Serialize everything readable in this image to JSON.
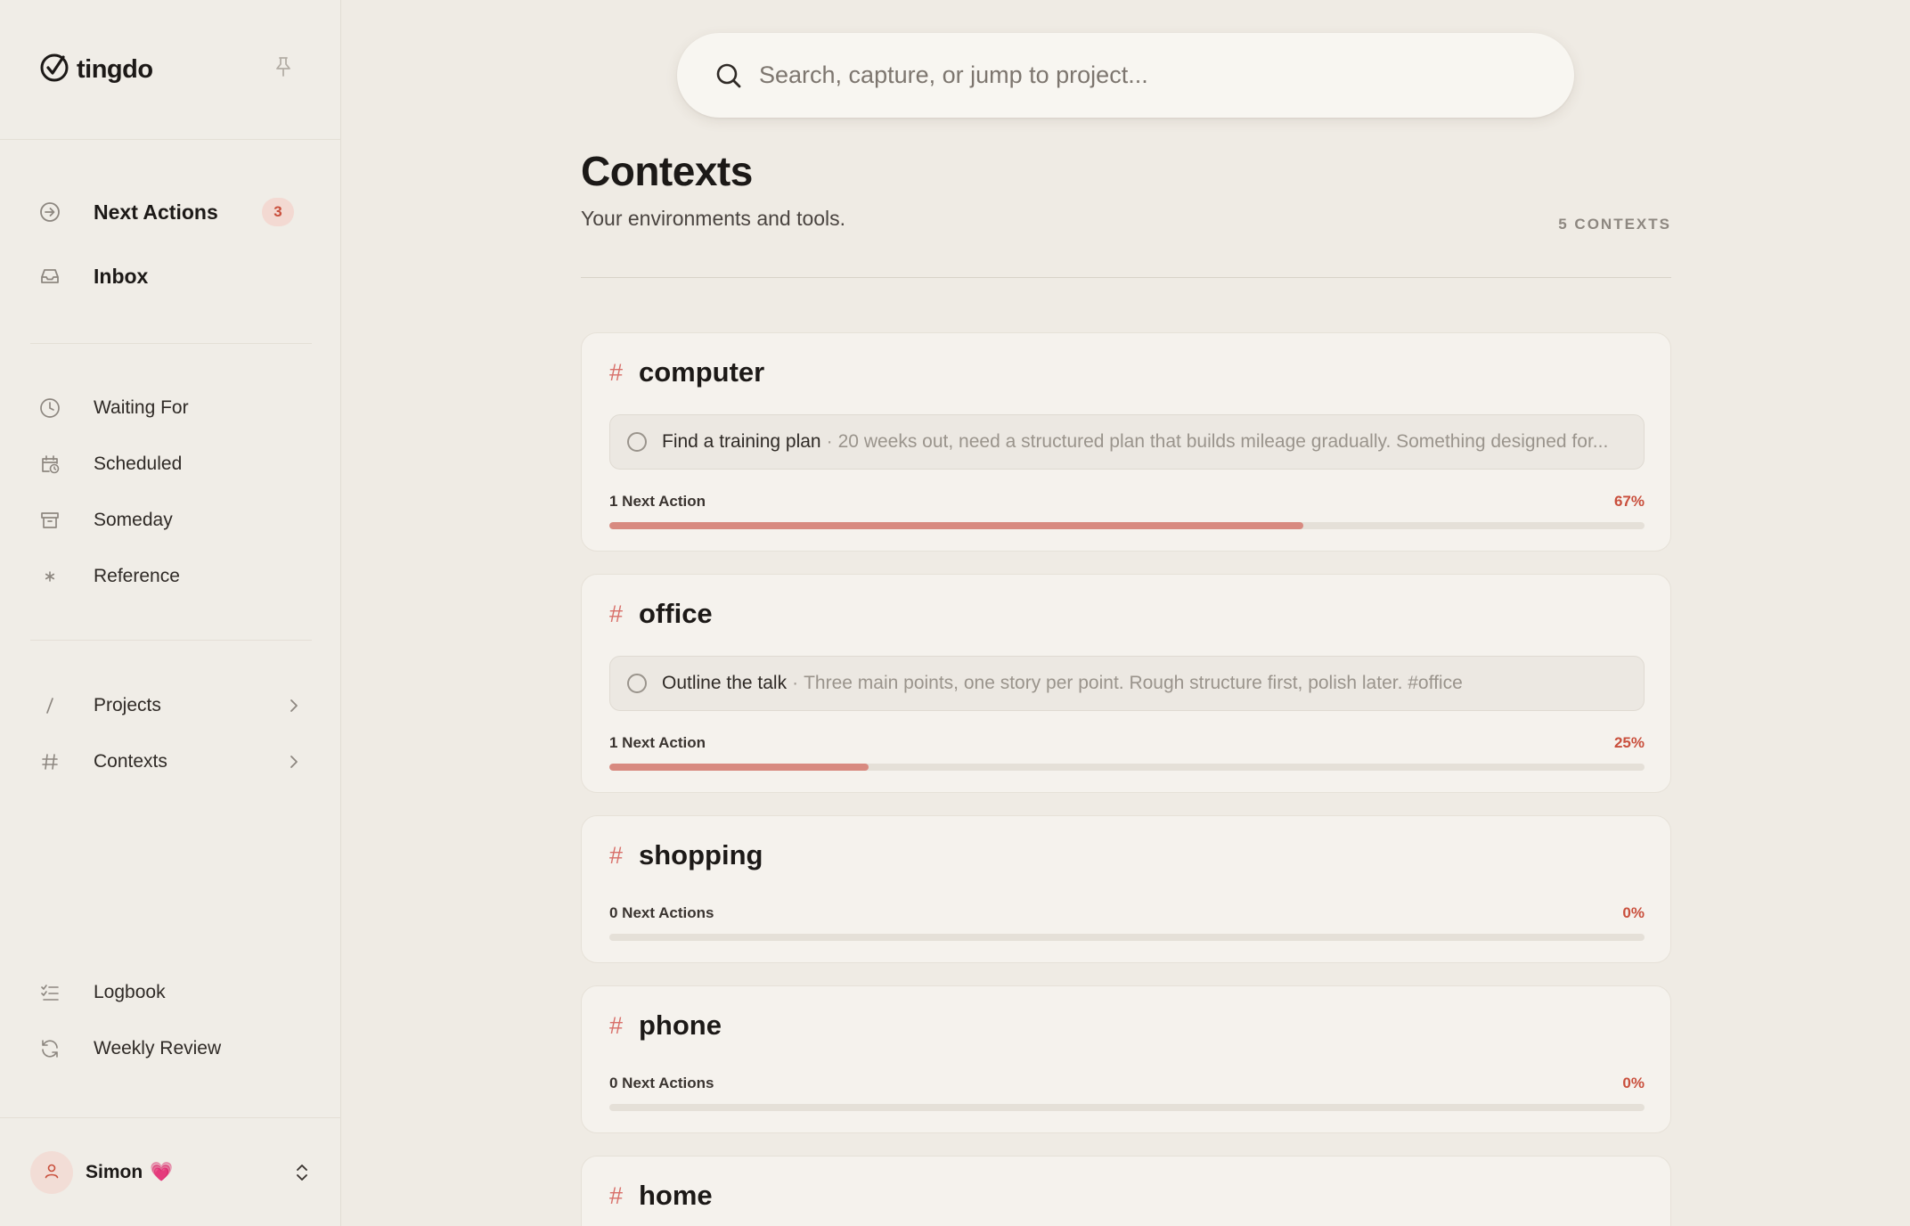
{
  "app": {
    "name": "tingdo"
  },
  "sidebar": {
    "primary": [
      {
        "label": "Next Actions",
        "badge": "3",
        "icon": "arrow-circle-right-icon"
      },
      {
        "label": "Inbox",
        "icon": "inbox-tray-icon"
      }
    ],
    "secondary": [
      {
        "label": "Waiting For",
        "icon": "clock-icon"
      },
      {
        "label": "Scheduled",
        "icon": "calendar-clock-icon"
      },
      {
        "label": "Someday",
        "icon": "archive-box-icon"
      },
      {
        "label": "Reference",
        "icon": "asterisk-icon"
      }
    ],
    "collections": [
      {
        "label": "Projects",
        "icon": "slash-icon"
      },
      {
        "label": "Contexts",
        "icon": "hash-icon"
      }
    ],
    "footer_items": [
      {
        "label": "Logbook",
        "icon": "checklist-icon"
      },
      {
        "label": "Weekly Review",
        "icon": "refresh-icon"
      }
    ],
    "user": {
      "name": "Simon",
      "emoji": "💗"
    }
  },
  "search": {
    "placeholder": "Search, capture, or jump to project..."
  },
  "page": {
    "title": "Contexts",
    "subtitle": "Your environments and tools.",
    "count_label": "5 CONTEXTS"
  },
  "contexts": [
    {
      "name": "computer",
      "task": {
        "title": "Find a training plan",
        "separator": "·",
        "note": "20 weeks out, need a structured plan that builds mileage gradually. Something designed for..."
      },
      "stat_label": "1 Next Action",
      "percent_label": "67%",
      "progress": 0.67
    },
    {
      "name": "office",
      "task": {
        "title": "Outline the talk",
        "separator": "·",
        "note": "Three main points, one story per point. Rough structure first, polish later. #office"
      },
      "stat_label": "1 Next Action",
      "percent_label": "25%",
      "progress": 0.25
    },
    {
      "name": "shopping",
      "stat_label": "0 Next Actions",
      "percent_label": "0%",
      "progress": 0
    },
    {
      "name": "phone",
      "stat_label": "0 Next Actions",
      "percent_label": "0%",
      "progress": 0
    },
    {
      "name": "home"
    }
  ],
  "colors": {
    "accent": "#c94f3c",
    "progress_fill": "#d88a80",
    "background": "#efebe4"
  }
}
